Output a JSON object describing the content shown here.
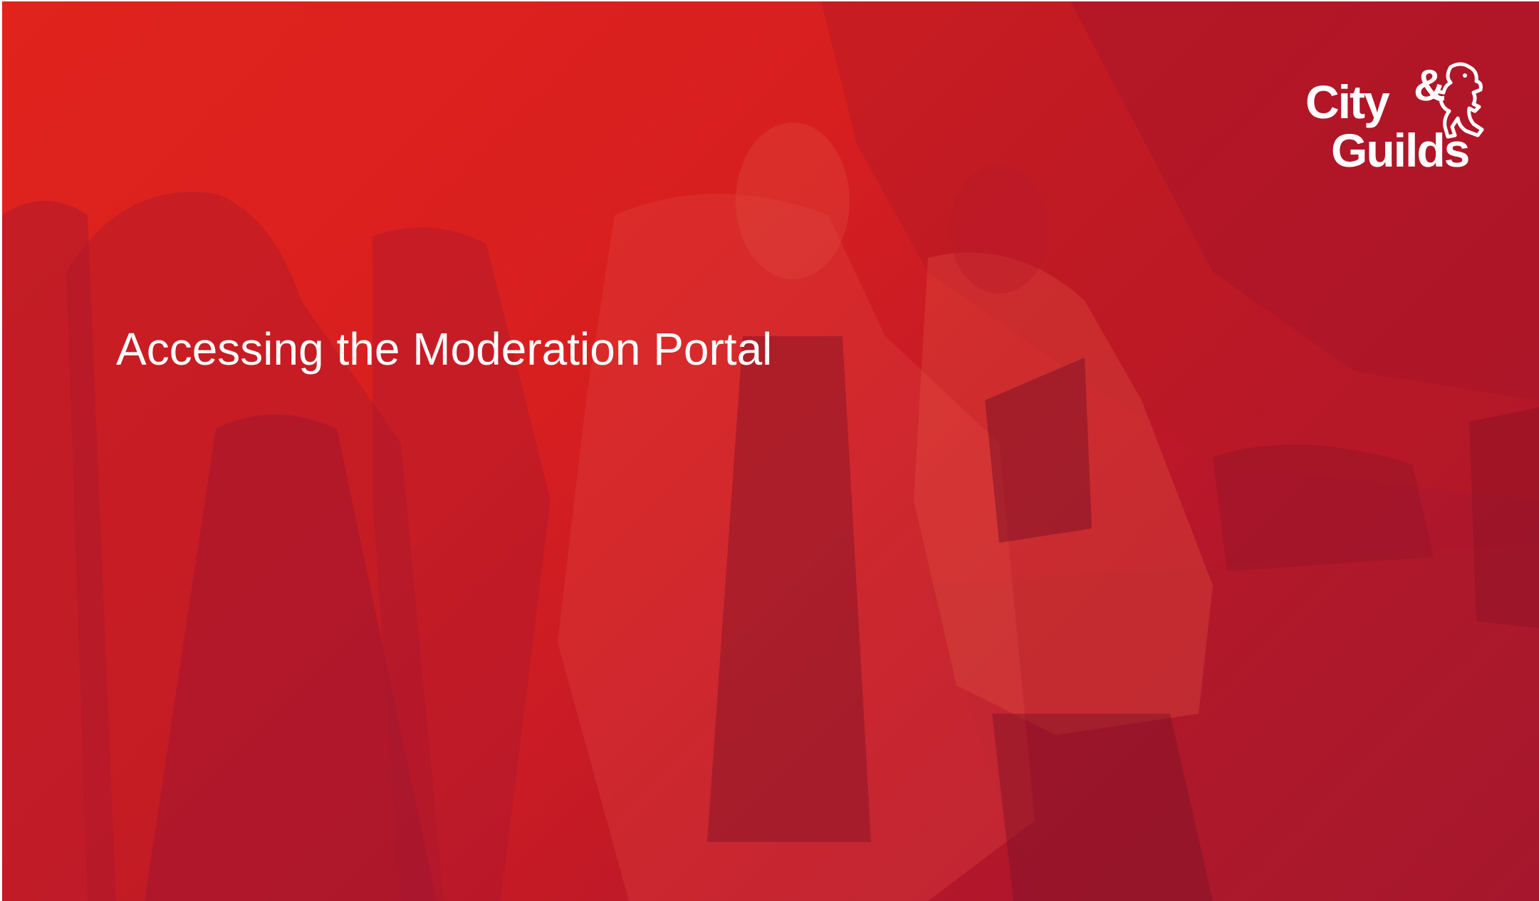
{
  "slide": {
    "title": "Accessing the Moderation Portal",
    "background_color": "#d81f20",
    "background_image": "people-walking-photo"
  },
  "logo": {
    "word_city": "City",
    "word_amp": "&",
    "word_guilds": "Guilds",
    "icon": "lion-icon",
    "color": "#ffffff"
  }
}
